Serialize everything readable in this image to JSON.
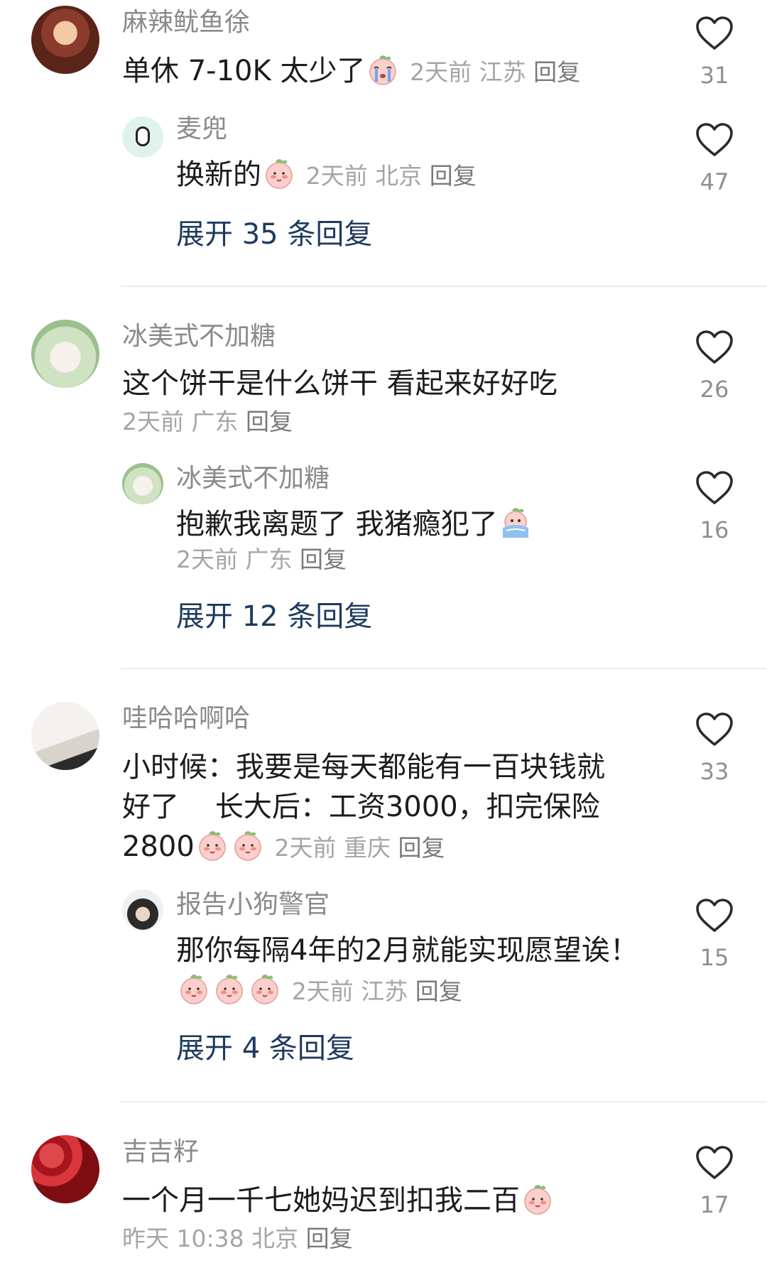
{
  "threads": [
    {
      "comment": {
        "username": "麻辣鱿鱼徐",
        "text": "单休 7-10K 太少了",
        "emoji": "crying-peach-emoji",
        "meta": "2天前  江苏",
        "reply": "回复",
        "likes": "31"
      },
      "reply": {
        "username": "麦兜",
        "text": "换新的",
        "emoji": "peach-emoji",
        "meta": "2天前  北京",
        "reply": "回复",
        "likes": "47"
      },
      "expand": "展开 35 条回复"
    },
    {
      "comment": {
        "username": "冰美式不加糖",
        "text": "这个饼干是什么饼干 看起来好好吃",
        "meta": "2天前  广东",
        "reply": "回复",
        "likes": "26"
      },
      "reply": {
        "username": "冰美式不加糖",
        "text": "抱歉我离题了 我猪瘾犯了",
        "emoji": "crying-blue-emoji",
        "meta": "2天前  广东",
        "reply": "回复",
        "likes": "16"
      },
      "expand": "展开 12 条回复"
    },
    {
      "comment": {
        "username": "哇哈哈啊哈",
        "line1": "小时候：我要是每天都能有一百块钱就",
        "line2": "好了    长大后：工资3000，扣完保险",
        "line3": "2800",
        "emoji": "peach-emoji",
        "meta": "2天前  重庆",
        "reply": "回复",
        "likes": "33"
      },
      "reply": {
        "username": "报告小狗警官",
        "line1": "那你每隔4年的2月就能实现愿望诶！",
        "emoji": "peach-emoji",
        "meta": "2天前  江苏",
        "reply": "回复",
        "likes": "15"
      },
      "expand": "展开 4 条回复"
    },
    {
      "comment": {
        "username": "吉吉籽",
        "text": "一个月一千七她妈迟到扣我二百",
        "emoji": "peach-emoji",
        "meta": "昨天 10:38  北京",
        "reply": "回复",
        "likes": "17"
      }
    }
  ],
  "colors": {
    "username": "#8a8a8a",
    "text": "#1c1c1c",
    "meta": "#a5a5a5",
    "expand": "#1f3a5f"
  }
}
